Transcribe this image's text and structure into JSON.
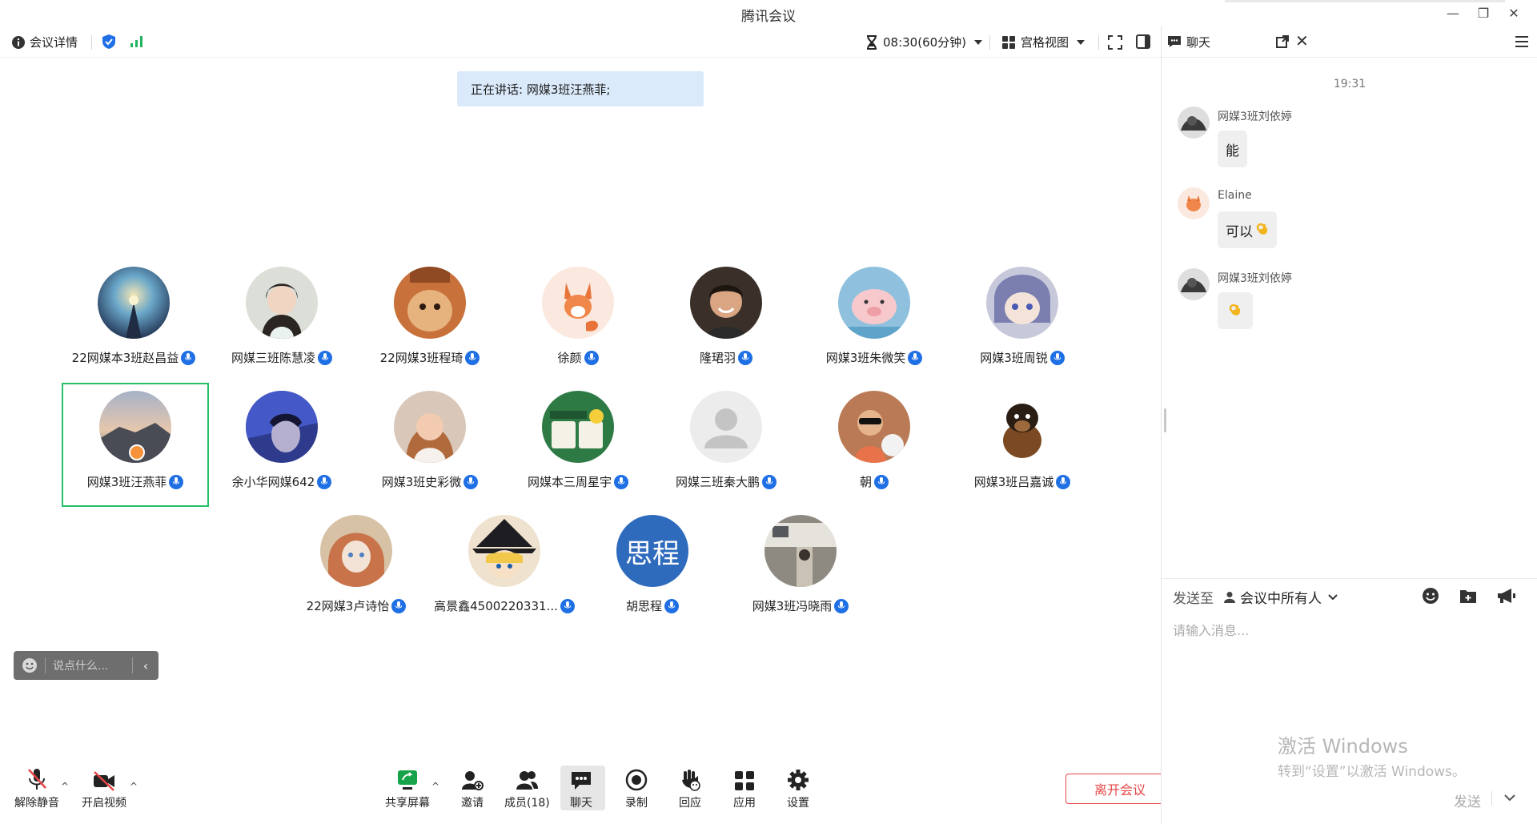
{
  "window": {
    "title": "腾讯会议"
  },
  "toolbar": {
    "meeting_info": "会议详情",
    "timer": "08:30(60分钟)",
    "view_mode": "宫格视图"
  },
  "stage": {
    "speaking": "正在讲话: 网媒3班汪燕菲;"
  },
  "participants": [
    {
      "name": "22网媒本3班赵昌益"
    },
    {
      "name": "网媒三班陈慧凌"
    },
    {
      "name": "22网媒3班程琦"
    },
    {
      "name": "徐颜"
    },
    {
      "name": "隆珺羽"
    },
    {
      "name": "网媒3班朱微笑"
    },
    {
      "name": "网媒3班周锐"
    },
    {
      "name": "网媒3班汪燕菲"
    },
    {
      "name": "余小华网媒642"
    },
    {
      "name": "网媒3班史彩微"
    },
    {
      "name": "网媒本三周星宇"
    },
    {
      "name": "网媒三班秦大鹏"
    },
    {
      "name": "朝"
    },
    {
      "name": "网媒3班吕嘉诚"
    },
    {
      "name": "22网媒3卢诗怡"
    },
    {
      "name": "高景鑫4500220331..."
    },
    {
      "name": "胡思程",
      "avatar_text": "思程"
    },
    {
      "name": "网媒3班冯晓雨"
    }
  ],
  "quick_chat": {
    "placeholder": "说点什么..."
  },
  "bottom_bar": {
    "unmute": "解除静音",
    "start_video": "开启视频",
    "share_screen": "共享屏幕",
    "invite": "邀请",
    "members": "成员(18)",
    "chat": "聊天",
    "record": "录制",
    "reactions": "回应",
    "apps": "应用",
    "settings": "设置",
    "leave": "离开会议"
  },
  "chat": {
    "title": "聊天",
    "timestamp": "19:31",
    "messages": [
      {
        "sender": "网媒3班刘依婷",
        "text": "能"
      },
      {
        "sender": "Elaine",
        "text": "可以"
      },
      {
        "sender": "网媒3班刘依婷",
        "text": ""
      }
    ],
    "send_to_label": "发送至",
    "send_to_target": "会议中所有人",
    "input_placeholder": "请输入消息...",
    "send_label": "发送"
  },
  "watermark": {
    "line1": "激活 Windows",
    "line2": "转到“设置”以激活 Windows。"
  },
  "colors": {
    "accent": "#1f6fe5",
    "active_border": "#25c06a",
    "leave": "#e54545",
    "speaking_bg": "#dbeafb"
  }
}
